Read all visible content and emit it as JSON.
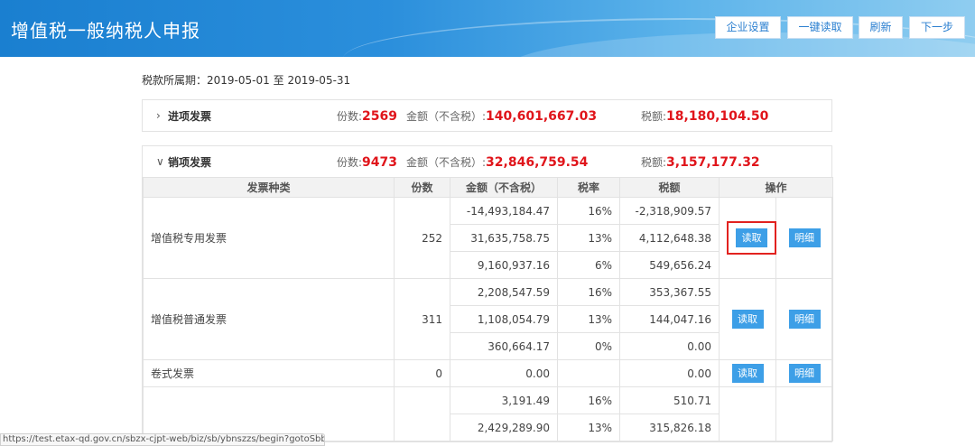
{
  "header": {
    "title": "增值税一般纳税人申报",
    "buttons": [
      "企业设置",
      "一键读取",
      "刷新",
      "下一步"
    ]
  },
  "period": {
    "label": "税款所属期：",
    "start": "2019-05-01",
    "sep": "至",
    "end": "2019-05-31"
  },
  "input_panel": {
    "chevron": "›",
    "title": "进项发票",
    "count_label": "份数:",
    "count": "2569",
    "amount_label": "金额（不含税）:",
    "amount": "140,601,667.03",
    "tax_label": "税额:",
    "tax": "18,180,104.50"
  },
  "output_panel": {
    "chevron": "∨",
    "title": "销项发票",
    "count_label": "份数:",
    "count": "9473",
    "amount_label": "金额（不含税）:",
    "amount": "32,846,759.54",
    "tax_label": "税额:",
    "tax": "3,157,177.32",
    "columns": [
      "发票种类",
      "份数",
      "金额（不含税）",
      "税率",
      "税额",
      "操作"
    ],
    "read_label": "读取",
    "detail_label": "明细",
    "groups": [
      {
        "kind": "增值税专用发票",
        "count": "252",
        "rows": [
          {
            "amount": "-14,493,184.47",
            "rate": "16%",
            "tax": "-2,318,909.57"
          },
          {
            "amount": "31,635,758.75",
            "rate": "13%",
            "tax": "4,112,648.38"
          },
          {
            "amount": "9,160,937.16",
            "rate": "6%",
            "tax": "549,656.24"
          }
        ]
      },
      {
        "kind": "增值税普通发票",
        "count": "311",
        "rows": [
          {
            "amount": "2,208,547.59",
            "rate": "16%",
            "tax": "353,367.55"
          },
          {
            "amount": "1,108,054.79",
            "rate": "13%",
            "tax": "144,047.16"
          },
          {
            "amount": "360,664.17",
            "rate": "0%",
            "tax": "0.00"
          }
        ]
      },
      {
        "kind": "卷式发票",
        "count": "0",
        "rows": [
          {
            "amount": "0.00",
            "rate": "",
            "tax": "0.00"
          }
        ]
      },
      {
        "kind": "",
        "count": "",
        "rows": [
          {
            "amount": "3,191.49",
            "rate": "16%",
            "tax": "510.71"
          },
          {
            "amount": "2,429,289.90",
            "rate": "13%",
            "tax": "315,826.18"
          }
        ]
      }
    ]
  },
  "status_url": "https://test.etax-qd.gov.cn/sbzx-cjpt-web/biz/sb/ybnszzs/begin?gotoSbb="
}
